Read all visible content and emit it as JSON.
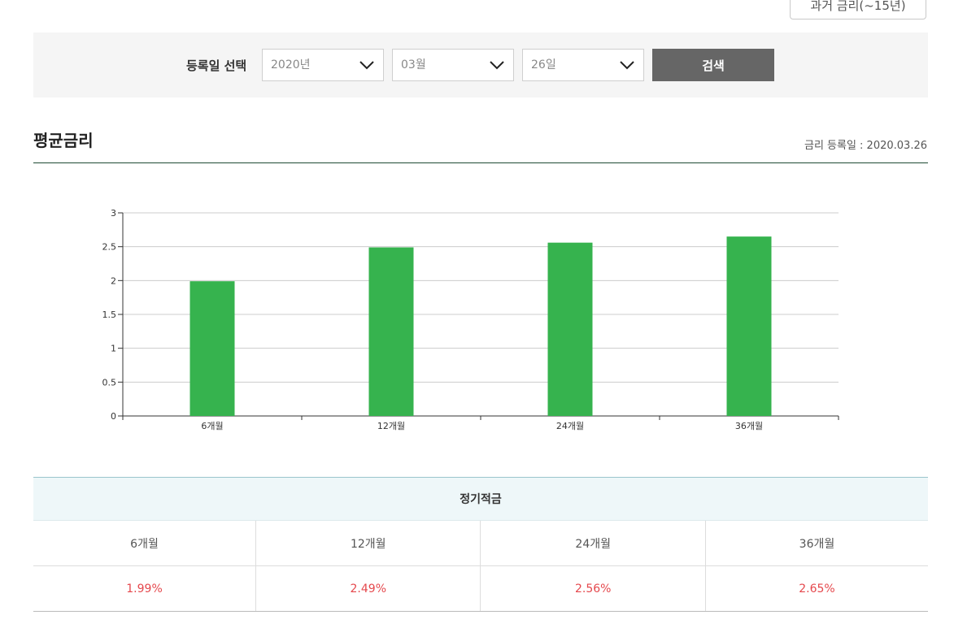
{
  "header": {
    "past_rates_button": "과거 금리(~15년)"
  },
  "search": {
    "label": "등록일 선택",
    "year": "2020년",
    "month": "03월",
    "day": "26일",
    "search_button": "검색"
  },
  "section": {
    "title": "평균금리",
    "registration_date": "금리 등록일 : 2020.03.26"
  },
  "chart_data": {
    "type": "bar",
    "categories": [
      "6개월",
      "12개월",
      "24개월",
      "36개월"
    ],
    "values": [
      1.99,
      2.49,
      2.56,
      2.65
    ],
    "yticks": [
      "0",
      "0.5",
      "1",
      "1.5",
      "2",
      "2.5",
      "3"
    ],
    "ylim": [
      0,
      3
    ],
    "grid": true,
    "bar_color": "#36b34e"
  },
  "table": {
    "header": "정기적금",
    "periods": [
      "6개월",
      "12개월",
      "24개월",
      "36개월"
    ],
    "rates": [
      "1.99%",
      "2.49%",
      "2.56%",
      "2.65%"
    ],
    "rate_color": "#e5484d"
  }
}
